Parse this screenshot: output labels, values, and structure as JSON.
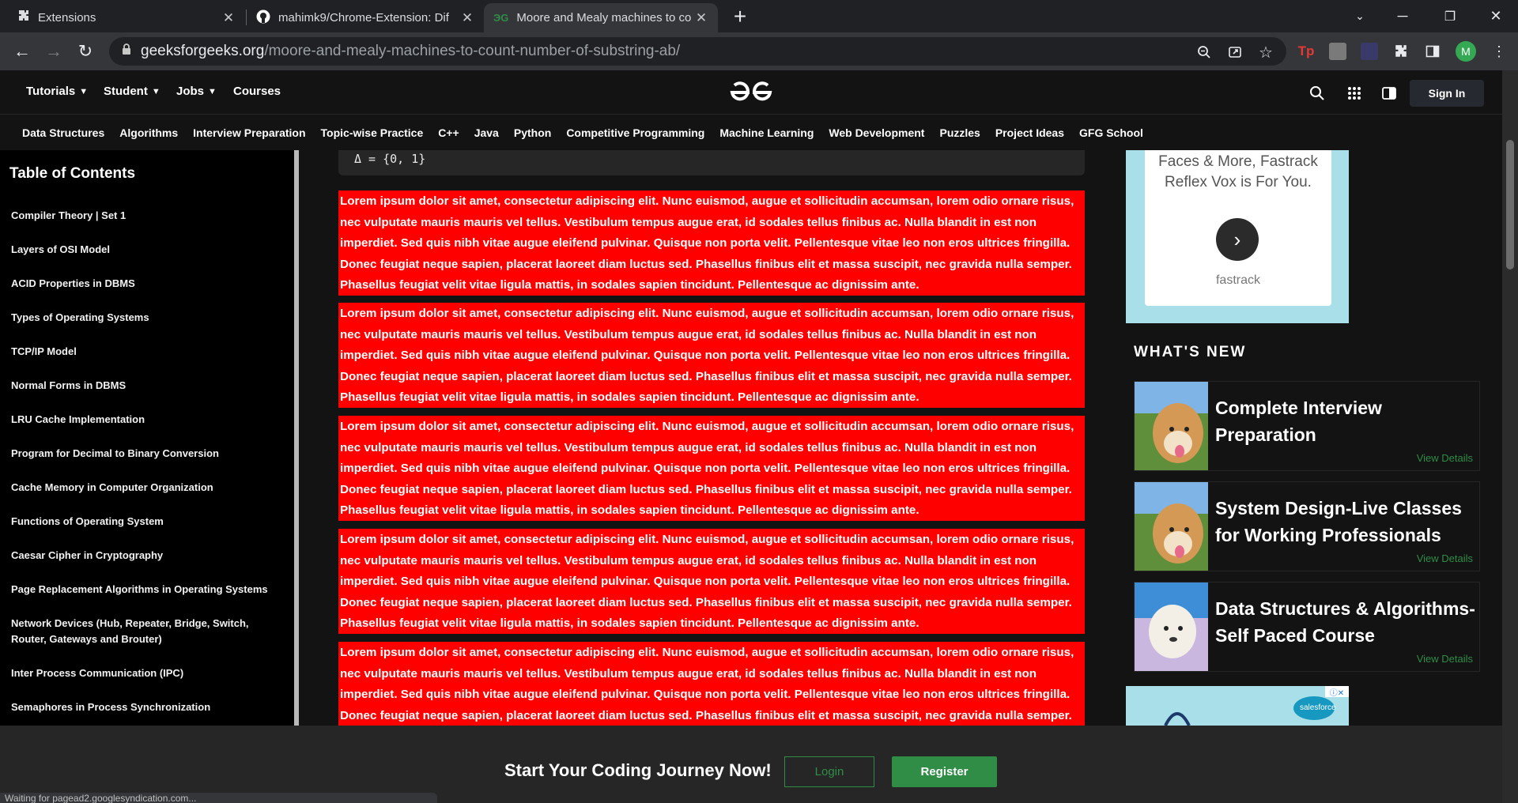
{
  "browser": {
    "tabs": [
      {
        "title": "Extensions",
        "icon": "puzzle-icon"
      },
      {
        "title": "mahimk9/Chrome-Extension: Dif",
        "icon": "github-icon"
      },
      {
        "title": "Moore and Mealy machines to co",
        "icon": "gfg-favicon-icon"
      }
    ],
    "url_host": "geeksforgeeks.org",
    "url_path": "/moore-and-mealy-machines-to-count-number-of-substring-ab/",
    "profile_initial": "M",
    "status_text": "Waiting for pagead2.googlesyndication.com..."
  },
  "header": {
    "nav": [
      "Tutorials",
      "Student",
      "Jobs",
      "Courses"
    ],
    "sign_in": "Sign In"
  },
  "subnav": [
    "Data Structures",
    "Algorithms",
    "Interview Preparation",
    "Topic-wise Practice",
    "C++",
    "Java",
    "Python",
    "Competitive Programming",
    "Machine Learning",
    "Web Development",
    "Puzzles",
    "Project Ideas",
    "GFG School"
  ],
  "toc": {
    "title": "Table of Contents",
    "items": [
      "Compiler Theory | Set 1",
      "Layers of OSI Model",
      "ACID Properties in DBMS",
      "Types of Operating Systems",
      "TCP/IP Model",
      "Normal Forms in DBMS",
      "LRU Cache Implementation",
      "Program for Decimal to Binary Conversion",
      "Cache Memory in Computer Organization",
      "Functions of Operating System",
      "Caesar Cipher in Cryptography",
      "Page Replacement Algorithms in Operating Systems",
      "Network Devices (Hub, Repeater, Bridge, Switch, Router, Gateways and Brouter)",
      "Inter Process Communication (IPC)",
      "Semaphores in Process Synchronization"
    ]
  },
  "main": {
    "code": "Δ = {0, 1}",
    "lorem": "Lorem ipsum dolor sit amet, consectetur adipiscing elit. Nunc euismod, augue et sollicitudin accumsan, lorem odio ornare risus, nec vulputate mauris mauris vel tellus. Vestibulum tempus augue erat, id sodales tellus finibus ac. Nulla blandit in est non imperdiet. Sed quis nibh vitae augue eleifend pulvinar. Quisque non porta velit. Pellentesque vitae leo non eros ultrices fringilla. Donec feugiat neque sapien, placerat laoreet diam luctus sed. Phasellus finibus elit et massa suscipit, nec gravida nulla semper. Phasellus feugiat velit vitae ligula mattis, in sodales sapien tincidunt. Pellentesque ac dignissim ante."
  },
  "sidebar": {
    "ad_text": "Faces & More, Fastrack Reflex Vox is For You.",
    "ad_brand": "fastrack",
    "whats_new": "WHAT'S NEW",
    "courses": [
      {
        "title": "Complete Interview Preparation",
        "link": "View Details"
      },
      {
        "title": "System Design-Live Classes for Working Professionals",
        "link": "View Details"
      },
      {
        "title": "Data Structures & Algorithms- Self Paced Course",
        "link": "View Details"
      }
    ],
    "ad_bottom_brand": "salesforce"
  },
  "banner": {
    "text": "Start Your Coding Journey Now!",
    "login": "Login",
    "register": "Register"
  },
  "colors": {
    "gfg_green": "#2f8d46",
    "highlight_red": "#ff0000"
  }
}
